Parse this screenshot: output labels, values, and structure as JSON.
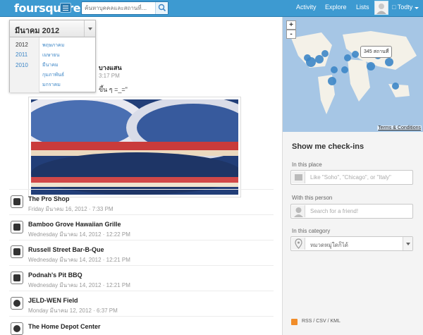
{
  "header": {
    "logo": "foursquare",
    "search_placeholder": "ค้นหาบุคคลและสถานที่...",
    "nav": [
      "Activity",
      "Explore",
      "Lists"
    ],
    "user": "Todty"
  },
  "month_picker": {
    "selected": "มีนาคม 2012",
    "years": [
      "2012",
      "2011",
      "2010"
    ],
    "months": [
      "พฤษภาคม",
      "เมษายน",
      "มีนาคม",
      "กุมภาพันธ์",
      "มกราคม"
    ]
  },
  "checkin": {
    "title": "บางแสน",
    "time": "3:17 PM",
    "shout": "ขึ้น ๆ =_=\""
  },
  "feed": [
    {
      "name": "The Pro Shop",
      "meta": "Friday มีนาคม 16, 2012 · 7:33 PM",
      "icon": "shopping-bag-icon"
    },
    {
      "name": "Bamboo Grove Hawaiian Grille",
      "meta": "Wednesday มีนาคม 14, 2012 · 12:22 PM",
      "icon": "pig-icon"
    },
    {
      "name": "Russell Street Bar-B-Que",
      "meta": "Wednesday มีนาคม 14, 2012 · 12:21 PM",
      "icon": "pig-icon"
    },
    {
      "name": "Podnah's Pit BBQ",
      "meta": "Wednesday มีนาคม 14, 2012 · 12:21 PM",
      "icon": "pig-icon"
    },
    {
      "name": "JELD-WEN Field",
      "meta": "Monday มีนาคม 12, 2012 · 6:37 PM",
      "icon": "soccer-ball-icon"
    },
    {
      "name": "The Home Depot Center",
      "meta": "",
      "icon": "soccer-ball-icon"
    }
  ],
  "map": {
    "tooltip": "345 สถานที่",
    "zoom_in": "+",
    "zoom_out": "-",
    "terms": "Terms & Conditions"
  },
  "filters": {
    "title": "Show me check-ins",
    "place_label": "In this place",
    "place_placeholder": "Like \"Soho\", \"Chicago\", or \"Italy\"",
    "person_label": "With this person",
    "person_placeholder": "Search for a friend!",
    "category_label": "In this category",
    "category_value": "หมวดหมู่ใดก็ได้"
  },
  "export_links": "RSS / CSV / KML"
}
